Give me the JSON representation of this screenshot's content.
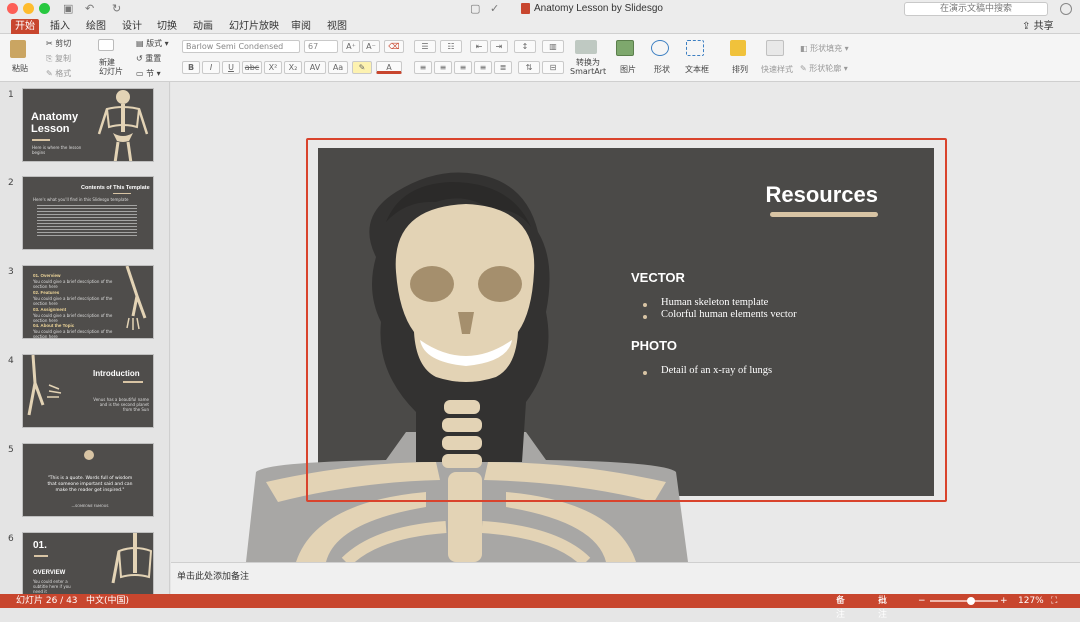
{
  "window": {
    "title": "Anatomy Lesson by Slidesgo",
    "search_placeholder": "在演示文稿中搜索"
  },
  "tabs": [
    "开始",
    "插入",
    "绘图",
    "设计",
    "切换",
    "动画",
    "幻灯片放映",
    "审阅",
    "视图"
  ],
  "share": "共享",
  "ribbon": {
    "paste": "粘贴",
    "cut": "剪切",
    "copy": "复制",
    "format": "格式",
    "new_slide": "新建\n幻灯片",
    "layout": "版式",
    "reset": "重置",
    "section": "节",
    "font_name": "Barlow Semi Condensed",
    "font_size": "67",
    "smartart": "转换为\nSmartArt",
    "picture": "图片",
    "shape": "形状",
    "textbox": "文本框",
    "arrange": "排列",
    "quick_styles": "快速样式",
    "shape_fill": "形状填充",
    "shape_outline": "形状轮廓",
    "format_buttons": [
      "B",
      "I",
      "U",
      "abc",
      "X²",
      "X₂",
      "AV",
      "Aa"
    ]
  },
  "thumbnails": [
    {
      "num": "1",
      "title": "Anatomy\nLesson",
      "sub": "Here is where the lesson begins"
    },
    {
      "num": "2",
      "title": "Contents of This Template",
      "sub": "Here's what you'll find in this Slidesgo template"
    },
    {
      "num": "3",
      "items": [
        "01. Overview",
        "02. Features",
        "03. Assignment",
        "04. About the Topic"
      ],
      "sub": "You could give a brief description of the section here"
    },
    {
      "num": "4",
      "title": "Introduction",
      "sub": "Venus has a beautiful name and is the second planet from the Sun"
    },
    {
      "num": "5",
      "quote": "\"This is a quote. Words full of wisdom that someone important said and can make the reader get inspired.\"",
      "author": "—SOMEONE FAMOUS"
    },
    {
      "num": "6",
      "title": "01.",
      "sub_title": "OVERVIEW",
      "sub": "You could enter a subtitle here if you need it"
    }
  ],
  "slide": {
    "title": "Resources",
    "sections": [
      {
        "heading": "VECTOR",
        "items": [
          "Human skeleton template",
          "Colorful human elements vector"
        ]
      },
      {
        "heading": "PHOTO",
        "items": [
          "Detail of an x-ray of lungs"
        ]
      }
    ]
  },
  "notes_placeholder": "单击此处添加备注",
  "status": {
    "slide_counter": "幻灯片 26 / 43",
    "language": "中文(中国)",
    "notes_btn": "备注",
    "comments_btn": "批注",
    "zoom": "127%",
    "zoom_level": 0.6
  },
  "colors": {
    "accent": "#c8462e",
    "slide_bg": "#4b4a48",
    "bone": "#e3d3b5",
    "selection": "#d9432c"
  }
}
